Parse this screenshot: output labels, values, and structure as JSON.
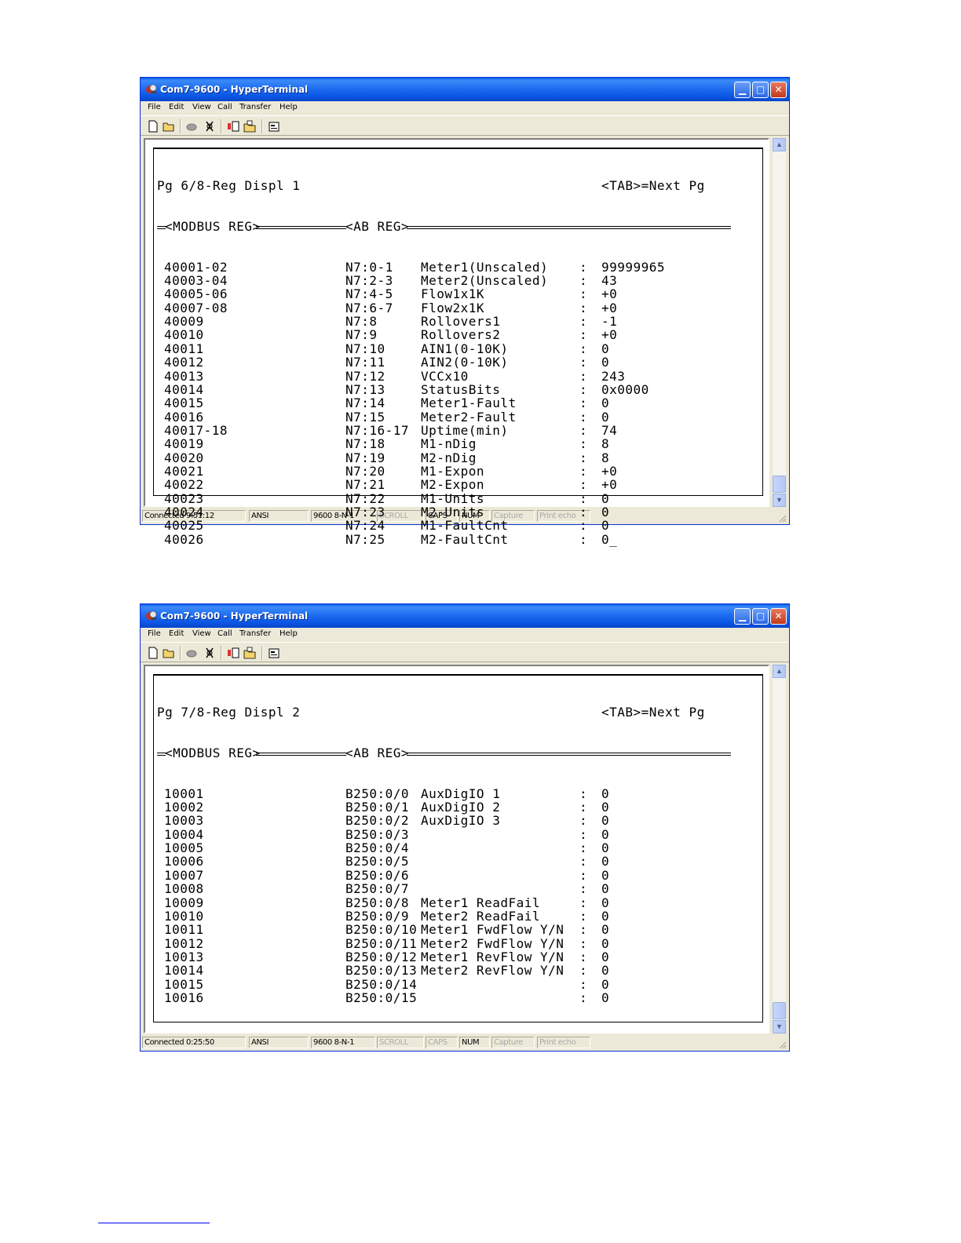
{
  "window1": {
    "title": "Com7-9600 - HyperTerminal",
    "menu": [
      "File",
      "Edit",
      "View",
      "Call",
      "Transfer",
      "Help"
    ],
    "terminal": {
      "page_label": "Pg 6/8-Reg Displ 1",
      "next_label": "<TAB>=Next Pg",
      "modbus_header": "<MODBUS REG>",
      "ab_header": "<AB REG>",
      "rows": [
        {
          "reg": "40001-02",
          "ab": "N7:0-1",
          "name": "Meter1(Unscaled)",
          "colon": ":",
          "val": "99999965"
        },
        {
          "reg": "40003-04",
          "ab": "N7:2-3",
          "name": "Meter2(Unscaled)",
          "colon": ":",
          "val": "43"
        },
        {
          "reg": "40005-06",
          "ab": "N7:4-5",
          "name": "Flow1x1K",
          "colon": ":",
          "val": "+0"
        },
        {
          "reg": "40007-08",
          "ab": "N7:6-7",
          "name": "Flow2x1K",
          "colon": ":",
          "val": "+0"
        },
        {
          "reg": "40009",
          "ab": "N7:8",
          "name": "Rollovers1",
          "colon": ":",
          "val": "-1"
        },
        {
          "reg": "40010",
          "ab": "N7:9",
          "name": "Rollovers2",
          "colon": ":",
          "val": "+0"
        },
        {
          "reg": "40011",
          "ab": "N7:10",
          "name": "AIN1(0-10K)",
          "colon": ":",
          "val": "0"
        },
        {
          "reg": "40012",
          "ab": "N7:11",
          "name": "AIN2(0-10K)",
          "colon": ":",
          "val": "0"
        },
        {
          "reg": "40013",
          "ab": "N7:12",
          "name": "VCCx10",
          "colon": ":",
          "val": "243"
        },
        {
          "reg": "40014",
          "ab": "N7:13",
          "name": "StatusBits",
          "colon": ":",
          "val": "0x0000"
        },
        {
          "reg": "40015",
          "ab": "N7:14",
          "name": "Meter1-Fault",
          "colon": ":",
          "val": "0"
        },
        {
          "reg": "40016",
          "ab": "N7:15",
          "name": "Meter2-Fault",
          "colon": ":",
          "val": "0"
        },
        {
          "reg": "40017-18",
          "ab": "N7:16-17",
          "name": "Uptime(min)",
          "colon": ":",
          "val": "74"
        },
        {
          "reg": "40019",
          "ab": "N7:18",
          "name": "M1-nDig",
          "colon": ":",
          "val": "8"
        },
        {
          "reg": "40020",
          "ab": "N7:19",
          "name": "M2-nDig",
          "colon": ":",
          "val": "8"
        },
        {
          "reg": "40021",
          "ab": "N7:20",
          "name": "M1-Expon",
          "colon": ":",
          "val": "+0"
        },
        {
          "reg": "40022",
          "ab": "N7:21",
          "name": "M2-Expon",
          "colon": ":",
          "val": "+0"
        },
        {
          "reg": "40023",
          "ab": "N7:22",
          "name": "M1-Units",
          "colon": ":",
          "val": "0"
        },
        {
          "reg": "40024",
          "ab": "N7:23",
          "name": "M2-Units",
          "colon": ":",
          "val": "0"
        },
        {
          "reg": "40025",
          "ab": "N7:24",
          "name": "M1-FaultCnt",
          "colon": ":",
          "val": "0"
        },
        {
          "reg": "40026",
          "ab": "N7:25",
          "name": "M2-FaultCnt",
          "colon": ":",
          "val": "0_"
        }
      ]
    },
    "status": {
      "connected": "Connected 9:51:12",
      "emulation": "ANSI",
      "port_settings": "9600 8-N-1",
      "scroll": "SCROLL",
      "caps": "CAPS",
      "num": "NUM",
      "capture": "Capture",
      "print_echo": "Print echo"
    }
  },
  "window2": {
    "title": "Com7-9600 - HyperTerminal",
    "menu": [
      "File",
      "Edit",
      "View",
      "Call",
      "Transfer",
      "Help"
    ],
    "terminal": {
      "page_label": "Pg 7/8-Reg Displ 2",
      "next_label": "<TAB>=Next Pg",
      "modbus_header": "<MODBUS REG>",
      "ab_header": "<AB REG>",
      "rows": [
        {
          "reg": "10001",
          "ab": "B250:0/0",
          "name": "AuxDigIO 1",
          "colon": ":",
          "val": "0"
        },
        {
          "reg": "10002",
          "ab": "B250:0/1",
          "name": "AuxDigIO 2",
          "colon": ":",
          "val": "0"
        },
        {
          "reg": "10003",
          "ab": "B250:0/2",
          "name": "AuxDigIO 3",
          "colon": ":",
          "val": "0"
        },
        {
          "reg": "10004",
          "ab": "B250:0/3",
          "name": "",
          "colon": ":",
          "val": "0"
        },
        {
          "reg": "10005",
          "ab": "B250:0/4",
          "name": "",
          "colon": ":",
          "val": "0"
        },
        {
          "reg": "10006",
          "ab": "B250:0/5",
          "name": "",
          "colon": ":",
          "val": "0"
        },
        {
          "reg": "10007",
          "ab": "B250:0/6",
          "name": "",
          "colon": ":",
          "val": "0"
        },
        {
          "reg": "10008",
          "ab": "B250:0/7",
          "name": "",
          "colon": ":",
          "val": "0"
        },
        {
          "reg": "10009",
          "ab": "B250:0/8",
          "name": "Meter1 ReadFail",
          "colon": ":",
          "val": "0"
        },
        {
          "reg": "10010",
          "ab": "B250:0/9",
          "name": "Meter2 ReadFail",
          "colon": ":",
          "val": "0"
        },
        {
          "reg": "10011",
          "ab": "B250:0/10",
          "name": "Meter1 FwdFlow Y/N",
          "colon": ":",
          "val": "0"
        },
        {
          "reg": "10012",
          "ab": "B250:0/11",
          "name": "Meter2 FwdFlow Y/N",
          "colon": ":",
          "val": "0"
        },
        {
          "reg": "10013",
          "ab": "B250:0/12",
          "name": "Meter1 RevFlow Y/N",
          "colon": ":",
          "val": "0"
        },
        {
          "reg": "10014",
          "ab": "B250:0/13",
          "name": "Meter2 RevFlow Y/N",
          "colon": ":",
          "val": "0"
        },
        {
          "reg": "10015",
          "ab": "B250:0/14",
          "name": "",
          "colon": ":",
          "val": "0"
        },
        {
          "reg": "10016",
          "ab": "B250:0/15",
          "name": "",
          "colon": ":",
          "val": "0"
        }
      ]
    },
    "status": {
      "connected": "Connected 0:25:50",
      "emulation": "ANSI",
      "port_settings": "9600 8-N-1",
      "scroll": "SCROLL",
      "caps": "CAPS",
      "num": "NUM",
      "capture": "Capture",
      "print_echo": "Print echo"
    }
  },
  "icons": [
    "app-icon",
    "new-file-icon",
    "open-folder-icon",
    "call-icon",
    "disconnect-icon",
    "send-icon",
    "receive-icon",
    "properties-icon",
    "minimize-icon",
    "maximize-icon",
    "close-icon",
    "resize-grip-icon"
  ]
}
